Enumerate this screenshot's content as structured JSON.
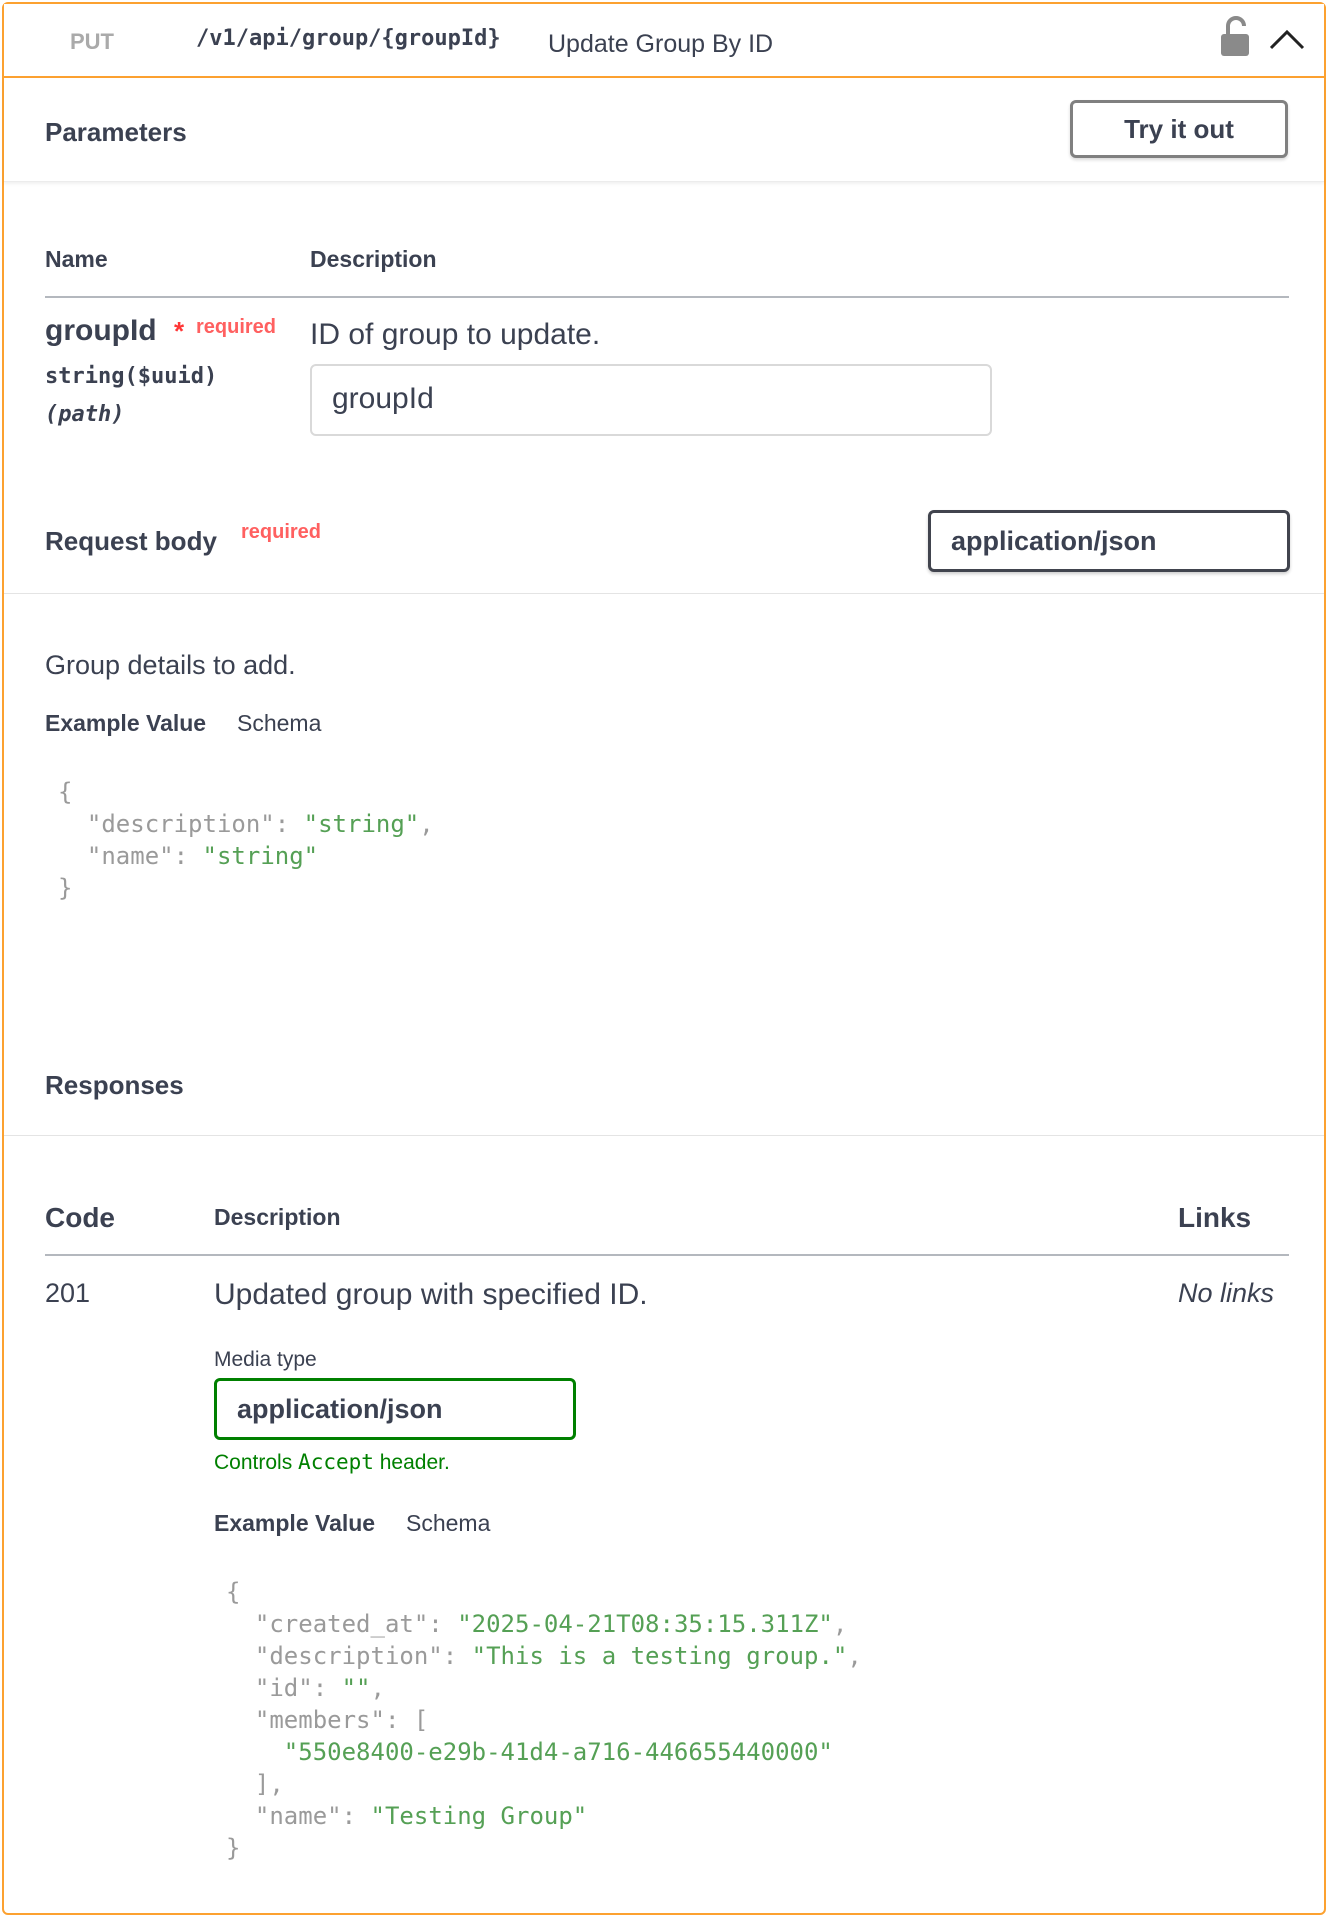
{
  "operation": {
    "method": "PUT",
    "path": "/v1/api/group/{groupId}",
    "summary": "Update Group By ID"
  },
  "parameters": {
    "title": "Parameters",
    "try_label": "Try it out",
    "col_name": "Name",
    "col_description": "Description",
    "param": {
      "name": "groupId",
      "star": "*",
      "required": "required",
      "type": "string($uuid)",
      "in": "(path)",
      "description": "ID of group to update.",
      "placeholder": "groupId"
    }
  },
  "request_body": {
    "title": "Request body",
    "required": "required",
    "content_type": "application/json",
    "description": "Group details to add.",
    "tab_example": "Example Value",
    "tab_schema": "Schema",
    "example": {
      "open": "{",
      "k1": "\"description\"",
      "v1": "\"string\"",
      "k2": "\"name\"",
      "v2": "\"string\"",
      "close": "}"
    }
  },
  "responses": {
    "title": "Responses",
    "col_code": "Code",
    "col_description": "Description",
    "col_links": "Links",
    "row": {
      "code": "201",
      "description": "Updated group with specified ID.",
      "links": "No links",
      "media_type_label": "Media type",
      "media_type": "application/json",
      "controls_prefix": "Controls",
      "controls_code": "Accept",
      "controls_suffix": "header.",
      "tab_example": "Example Value",
      "tab_schema": "Schema",
      "example": {
        "open": "{",
        "k1": "\"created_at\"",
        "v1": "\"2025-04-21T08:35:15.311Z\"",
        "k2": "\"description\"",
        "v2": "\"This is a testing group.\"",
        "k3": "\"id\"",
        "v3": "\"\"",
        "k4": "\"members\"",
        "arr_open": "[",
        "v4": "\"550e8400-e29b-41d4-a716-446655440000\"",
        "arr_close": "],",
        "k5": "\"name\"",
        "v5": "\"Testing Group\"",
        "close": "}"
      }
    }
  },
  "colors": {
    "put_accent": "#fca130",
    "required": "#ff6060",
    "success": "#008000",
    "string_value": "#55a055"
  },
  "icons": {
    "lock": "unlocked-padlock-icon",
    "chevron": "chevron-up-icon"
  }
}
